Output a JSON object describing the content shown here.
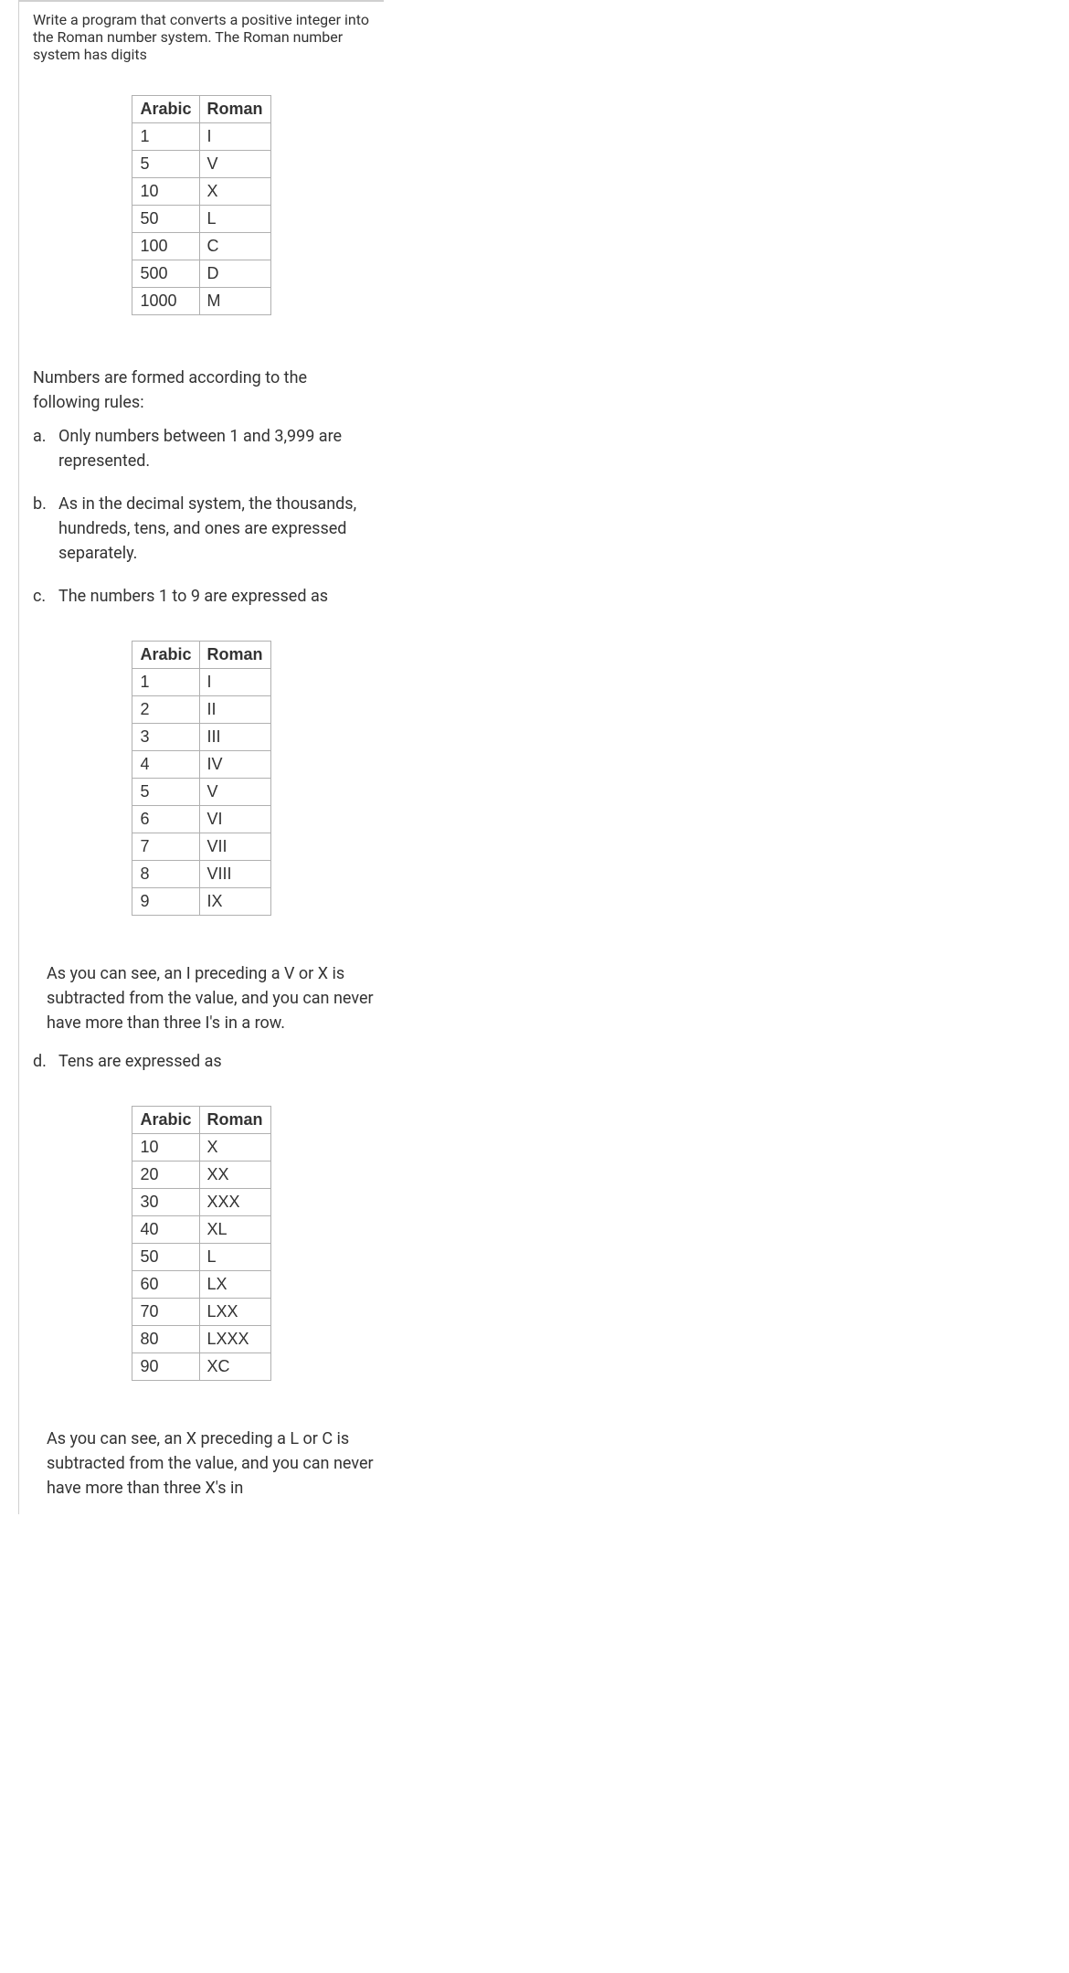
{
  "intro": "Write a program that converts a positive integer into the Roman number system. The Roman number system has digits",
  "headers": {
    "arabic": "Arabic",
    "roman": "Roman"
  },
  "table1": [
    {
      "arabic": "1",
      "roman": "I"
    },
    {
      "arabic": "5",
      "roman": "V"
    },
    {
      "arabic": "10",
      "roman": "X"
    },
    {
      "arabic": "50",
      "roman": "L"
    },
    {
      "arabic": "100",
      "roman": "C"
    },
    {
      "arabic": "500",
      "roman": "D"
    },
    {
      "arabic": "1000",
      "roman": "M"
    }
  ],
  "rules_intro": "Numbers are formed according to the following rules:",
  "rule_a": {
    "marker": "a.",
    "text": "Only numbers between 1 and 3,999 are represented."
  },
  "rule_b": {
    "marker": "b.",
    "text": "As in the decimal system, the thousands, hundreds, tens, and ones are expressed separately."
  },
  "rule_c": {
    "marker": "c.",
    "text": "The numbers 1 to 9 are expressed as"
  },
  "table2": [
    {
      "arabic": "1",
      "roman": "I"
    },
    {
      "arabic": "2",
      "roman": "II"
    },
    {
      "arabic": "3",
      "roman": "III"
    },
    {
      "arabic": "4",
      "roman": "IV"
    },
    {
      "arabic": "5",
      "roman": "V"
    },
    {
      "arabic": "6",
      "roman": "VI"
    },
    {
      "arabic": "7",
      "roman": "VII"
    },
    {
      "arabic": "8",
      "roman": "VIII"
    },
    {
      "arabic": "9",
      "roman": "IX"
    }
  ],
  "rule_c_note": "As you can see, an I preceding a V or X is subtracted from the value, and you can never have more than three I's in a row.",
  "rule_d": {
    "marker": "d.",
    "text": "Tens are expressed as"
  },
  "table3": [
    {
      "arabic": "10",
      "roman": "X"
    },
    {
      "arabic": "20",
      "roman": "XX"
    },
    {
      "arabic": "30",
      "roman": "XXX"
    },
    {
      "arabic": "40",
      "roman": "XL"
    },
    {
      "arabic": "50",
      "roman": "L"
    },
    {
      "arabic": "60",
      "roman": "LX"
    },
    {
      "arabic": "70",
      "roman": "LXX"
    },
    {
      "arabic": "80",
      "roman": "LXXX"
    },
    {
      "arabic": "90",
      "roman": "XC"
    }
  ],
  "rule_d_note": "As you can see, an X preceding a L or C is subtracted from the value, and you can never have more than three X's in"
}
